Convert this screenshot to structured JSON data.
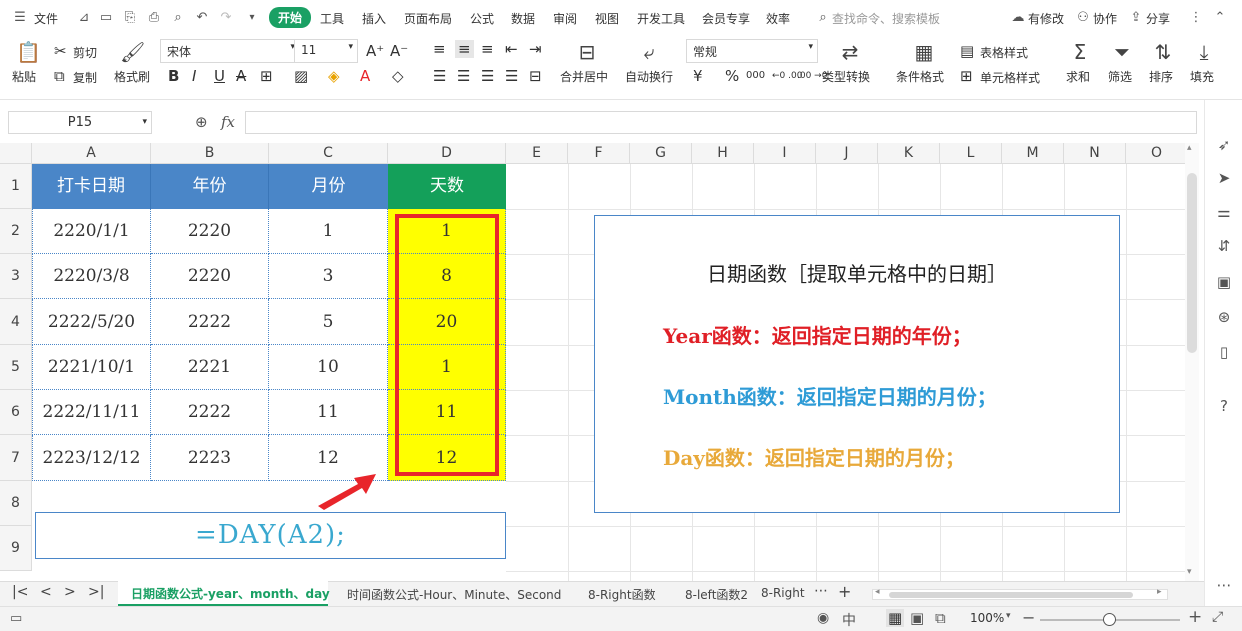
{
  "menubar": {
    "file_label": "文件",
    "tabs": [
      "开始",
      "工具",
      "插入",
      "页面布局",
      "公式",
      "数据",
      "审阅",
      "视图",
      "开发工具",
      "会员专享",
      "效率"
    ],
    "search_placeholder": "查找命令、搜索模板",
    "modified_label": "有修改",
    "collab_label": "协作",
    "share_label": "分享"
  },
  "ribbon": {
    "paste": "粘贴",
    "cut": "剪切",
    "copy": "复制",
    "format_painter": "格式刷",
    "font_name": "宋体",
    "font_size": "11",
    "merge_center": "合并居中",
    "wrap_text": "自动换行",
    "number_format": "常规",
    "type_convert": "类型转换",
    "conditional_format": "条件格式",
    "table_style": "表格样式",
    "cell_style": "单元格样式",
    "sum": "求和",
    "filter": "筛选",
    "sort": "排序",
    "fill": "填充",
    "currency_symbol": "¥",
    "percent_symbol": "%",
    "thousands": "000",
    "dec_inc": "←0 .00",
    "dec_dec": ".00 →0"
  },
  "formula_bar": {
    "name_box": "P15",
    "fx": "fx",
    "formula": ""
  },
  "grid": {
    "columns": [
      "A",
      "B",
      "C",
      "D",
      "E",
      "F",
      "G",
      "H",
      "I",
      "J",
      "K",
      "L",
      "M",
      "N",
      "O"
    ],
    "rows": [
      "1",
      "2",
      "3",
      "4",
      "5",
      "6",
      "7",
      "8",
      "9"
    ],
    "headers": [
      "打卡日期",
      "年份",
      "月份",
      "天数"
    ],
    "data": [
      [
        "2220/1/1",
        "2220",
        "1",
        "1"
      ],
      [
        "2220/3/8",
        "2220",
        "3",
        "8"
      ],
      [
        "2222/5/20",
        "2222",
        "5",
        "20"
      ],
      [
        "2221/10/1",
        "2221",
        "10",
        "1"
      ],
      [
        "2222/11/11",
        "2222",
        "11",
        "11"
      ],
      [
        "2223/12/12",
        "2223",
        "12",
        "12"
      ]
    ],
    "formula_display": "=DAY(A2);"
  },
  "info_box": {
    "title": "日期函数［提取单元格中的日期］",
    "line_year": "Year函数：返回指定日期的年份；",
    "line_month": "Month函数：返回指定日期的月份；",
    "line_day": "Day函数：返回指定日期的月份；"
  },
  "sheet_tabs": {
    "active": "日期函数公式-year、month、day",
    "tabs": [
      "时间函数公式-Hour、Minute、Second",
      "8-Right函数",
      "8-left函数2",
      "8-Right"
    ]
  },
  "statusbar": {
    "zoom": "100%"
  },
  "colors": {
    "brand_green": "#1aa064",
    "header_blue": "#4a86c8",
    "header_green": "#14a05a",
    "highlight_yellow": "#ffff00",
    "red": "#e8252b",
    "year_red": "#e01f26",
    "month_blue": "#2e9bd6",
    "day_orange": "#e8a93a",
    "formula_teal": "#3aa8cf"
  }
}
